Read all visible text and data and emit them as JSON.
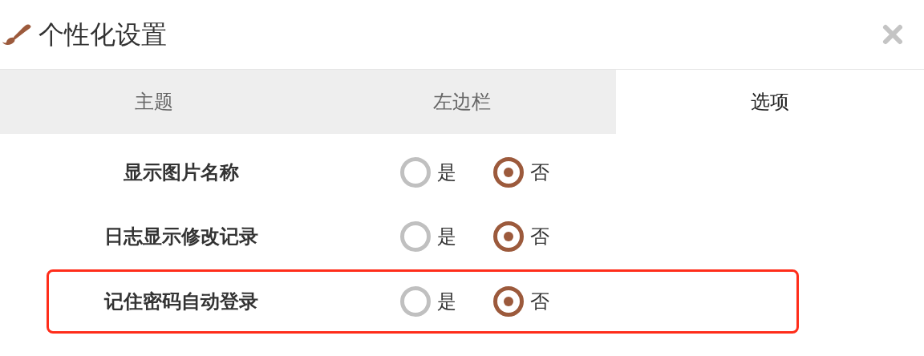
{
  "dialog": {
    "title": "个性化设置"
  },
  "tabs": [
    {
      "label": "主题",
      "selected": false
    },
    {
      "label": "左边栏",
      "selected": false
    },
    {
      "label": "选项",
      "selected": true
    }
  ],
  "settings": [
    {
      "label": "显示图片名称",
      "highlighted": false,
      "options": [
        {
          "label": "是",
          "selected": false
        },
        {
          "label": "否",
          "selected": true
        }
      ]
    },
    {
      "label": "日志显示修改记录",
      "highlighted": false,
      "options": [
        {
          "label": "是",
          "selected": false
        },
        {
          "label": "否",
          "selected": true
        }
      ]
    },
    {
      "label": "记住密码自动登录",
      "highlighted": true,
      "options": [
        {
          "label": "是",
          "selected": false
        },
        {
          "label": "否",
          "selected": true
        }
      ]
    }
  ]
}
